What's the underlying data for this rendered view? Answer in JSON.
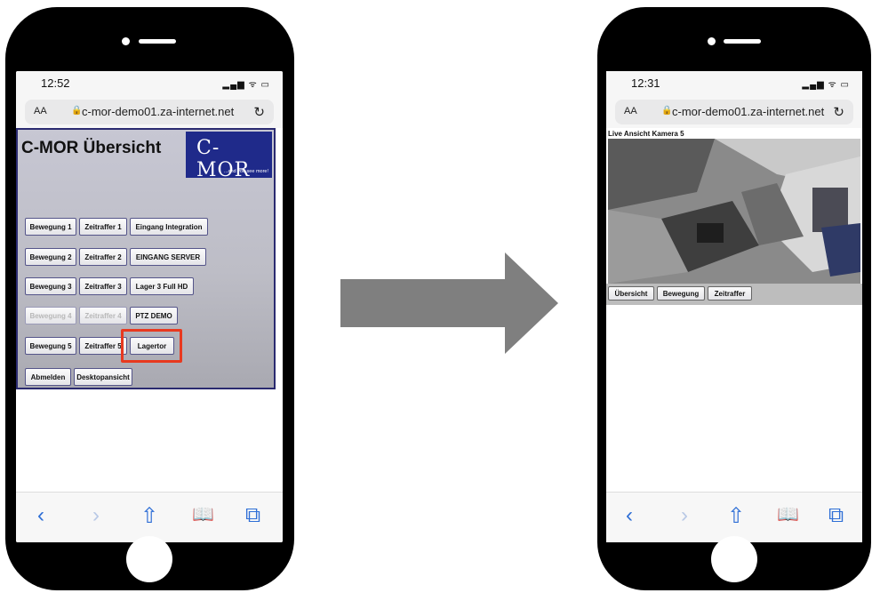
{
  "left_phone": {
    "status": {
      "time": "12:52",
      "indicators": "▂▄▆ ᯤ ▭"
    },
    "browser": {
      "text_size": "AA",
      "lock": "🔒",
      "url": "c-mor-demo01.za-internet.net",
      "reload": "↻"
    },
    "page": {
      "title": "C-MOR Übersicht",
      "logo_text": "C-MOR",
      "logo_tagline": "...and you see more!",
      "rows": [
        [
          "Bewegung 1",
          "Zeitraffer 1",
          "Eingang Integration"
        ],
        [
          "Bewegung 2",
          "Zeitraffer 2",
          "EINGANG SERVER"
        ],
        [
          "Bewegung 3",
          "Zeitraffer 3",
          "Lager 3  Full HD"
        ],
        [
          "Bewegung 4",
          "Zeitraffer 4",
          "PTZ DEMO"
        ],
        [
          "Bewegung 5",
          "Zeitraffer 5",
          "Lagertor"
        ],
        [
          "Abmelden",
          "Desktopansicht"
        ]
      ],
      "highlighted_button": "Lagertor",
      "highlight_color": "#e8391f"
    }
  },
  "right_phone": {
    "status": {
      "time": "12:31",
      "indicators": "▂▄▆ ᯤ ▭"
    },
    "browser": {
      "text_size": "AA",
      "lock": "🔒",
      "url": "c-mor-demo01.za-internet.net",
      "reload": "↻"
    },
    "page": {
      "live_title": "Live Ansicht Kamera 5",
      "buttons": [
        "Übersicht",
        "Bewegung",
        "Zeitraffer"
      ]
    }
  },
  "toolbar_icons": {
    "back": "‹",
    "forward": "›",
    "share": "⇧",
    "bookmarks": "📖",
    "tabs": "⧉"
  },
  "colors": {
    "arrow": "#7f7f7f",
    "logo_bg": "#1f2a8a",
    "panel_border": "#2a2a70"
  }
}
